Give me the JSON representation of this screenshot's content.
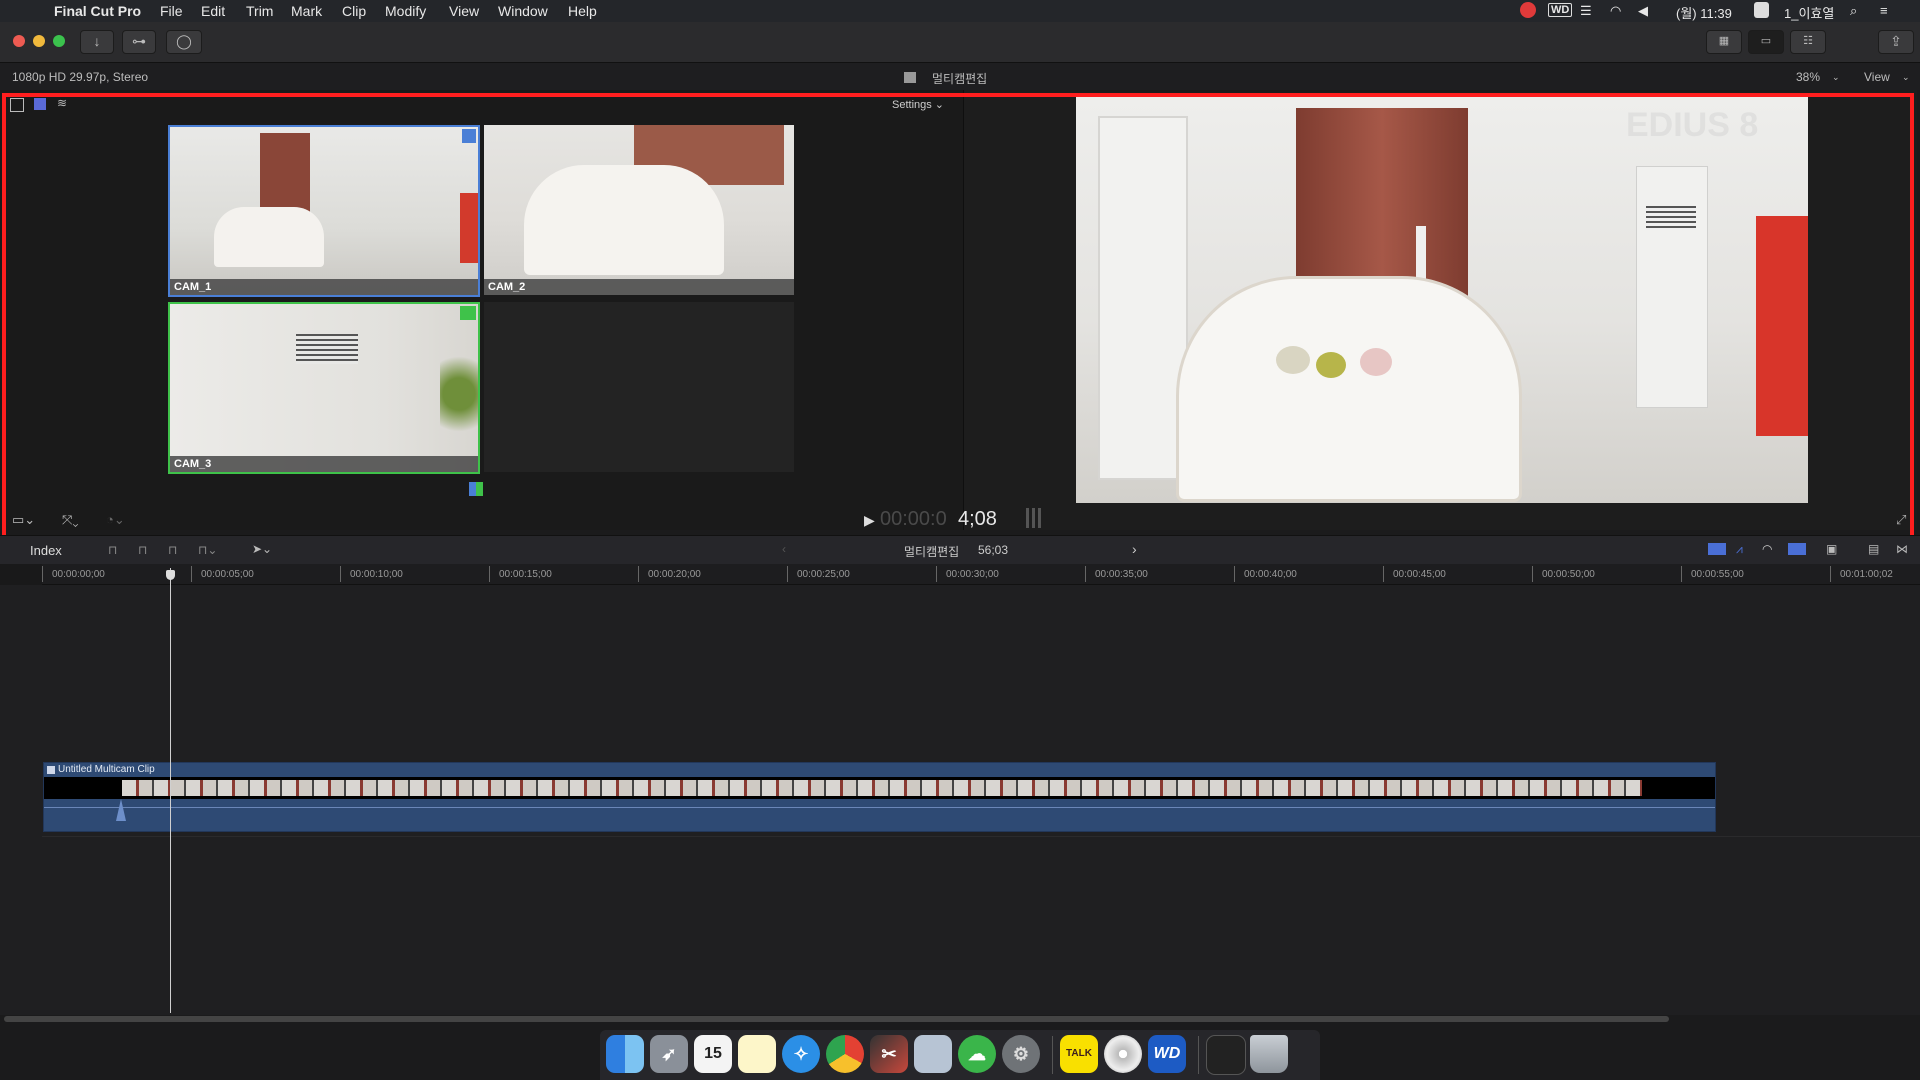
{
  "menubar": {
    "app_name": "Final Cut Pro",
    "items": [
      "File",
      "Edit",
      "Trim",
      "Mark",
      "Clip",
      "Modify",
      "View",
      "Window",
      "Help"
    ],
    "clock": "(월) 11:39",
    "user": "1_이효열",
    "wd_label": "WD"
  },
  "toolbar": {
    "import_glyph": "↓",
    "keyword_glyph": "⊶",
    "background_glyph": "◯"
  },
  "infobar": {
    "format": "1080p HD 29.97p, Stereo",
    "project_name": "멀티캠편집",
    "zoom": "38%",
    "view_label": "View"
  },
  "angle_viewer": {
    "settings_label": "Settings",
    "angles": [
      {
        "label": "CAM_1",
        "state": "active-video"
      },
      {
        "label": "CAM_2",
        "state": "none"
      },
      {
        "label": "CAM_3",
        "state": "active-audio"
      }
    ]
  },
  "viewer": {
    "timecode_dim": "00:00:0",
    "timecode_bright": "4;08",
    "watermark": "EDIUS 8"
  },
  "timeline_toolbar": {
    "index_label": "Index",
    "project_name": "멀티캠편집",
    "duration": "56;03"
  },
  "ruler": {
    "ticks": [
      "00:00:00;00",
      "00:00:05;00",
      "00:00:10;00",
      "00:00:15;00",
      "00:00:20;00",
      "00:00:25;00",
      "00:00:30;00",
      "00:00:35;00",
      "00:00:40;00",
      "00:00:45;00",
      "00:00:50;00",
      "00:00:55;00",
      "00:01:00;02"
    ]
  },
  "timeline": {
    "clip_title": "Untitled Multicam Clip"
  },
  "dock": {
    "calendar_day": "15",
    "kakao_label": "TALK",
    "wd_label": "WD"
  },
  "colors": {
    "highlight_red": "#ff1e1e",
    "active_video_blue": "#4a7fd6",
    "active_audio_green": "#3fc24a",
    "clip_blue": "#2e4a74"
  }
}
